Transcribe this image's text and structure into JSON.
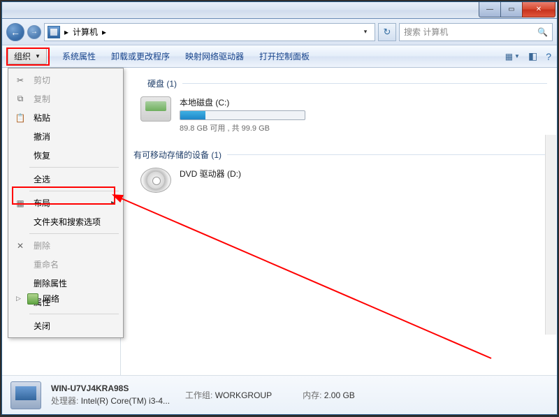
{
  "controls": {
    "min": "—",
    "max": "▭",
    "close": "✕"
  },
  "nav": {
    "back": "←",
    "fwd": "→",
    "dd": "▾",
    "refresh": "↻"
  },
  "address": {
    "path_root": "计算机",
    "arrow": "▸",
    "dd": "▾"
  },
  "search": {
    "placeholder": "搜索 计算机",
    "icon": "🔍"
  },
  "toolbar": {
    "organize": "组织",
    "sys_props": "系统属性",
    "uninstall": "卸载或更改程序",
    "map_drive": "映射网络驱动器",
    "control_panel": "打开控制面板",
    "help": "?"
  },
  "menu": {
    "cut": "剪切",
    "copy": "复制",
    "paste": "粘贴",
    "undo": "撤消",
    "redo": "恢复",
    "select_all": "全选",
    "layout": "布局",
    "folder_options": "文件夹和搜索选项",
    "delete": "删除",
    "rename": "重命名",
    "remove_props": "删除属性",
    "properties": "属性",
    "close": "关闭"
  },
  "tree": {
    "network_fragment": "网络"
  },
  "sections": {
    "hdd_header": "硬盘 (1)",
    "removable_header": "有可移动存储的设备 (1)"
  },
  "drives": {
    "c": {
      "label": "本地磁盘 (C:)",
      "status": "89.8 GB 可用 , 共 99.9 GB"
    },
    "d": {
      "label": "DVD 驱动器 (D:)"
    }
  },
  "details": {
    "name": "WIN-U7VJ4KRA98S",
    "workgroup_lbl": "工作组:",
    "workgroup_val": "WORKGROUP",
    "mem_lbl": "内存:",
    "mem_val": "2.00 GB",
    "cpu_lbl": "处理器:",
    "cpu_val": "Intel(R) Core(TM) i3-4..."
  }
}
